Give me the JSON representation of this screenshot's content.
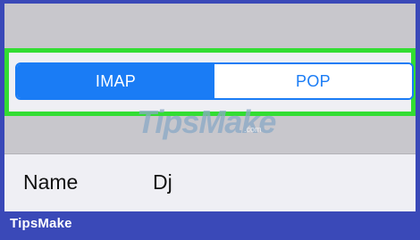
{
  "segmented_control": {
    "options": [
      {
        "label": "IMAP",
        "selected": true
      },
      {
        "label": "POP",
        "selected": false
      }
    ]
  },
  "watermark": {
    "text": "TipsMake",
    "domain_suffix": ".com"
  },
  "name_row": {
    "label": "Name",
    "value": "Dj"
  },
  "footer": {
    "brand": "TipsMake"
  },
  "colors": {
    "accent": "#1a7cf5",
    "highlight": "#33dd33",
    "frame": "#3a49b8",
    "background": "#c8c7cc"
  }
}
